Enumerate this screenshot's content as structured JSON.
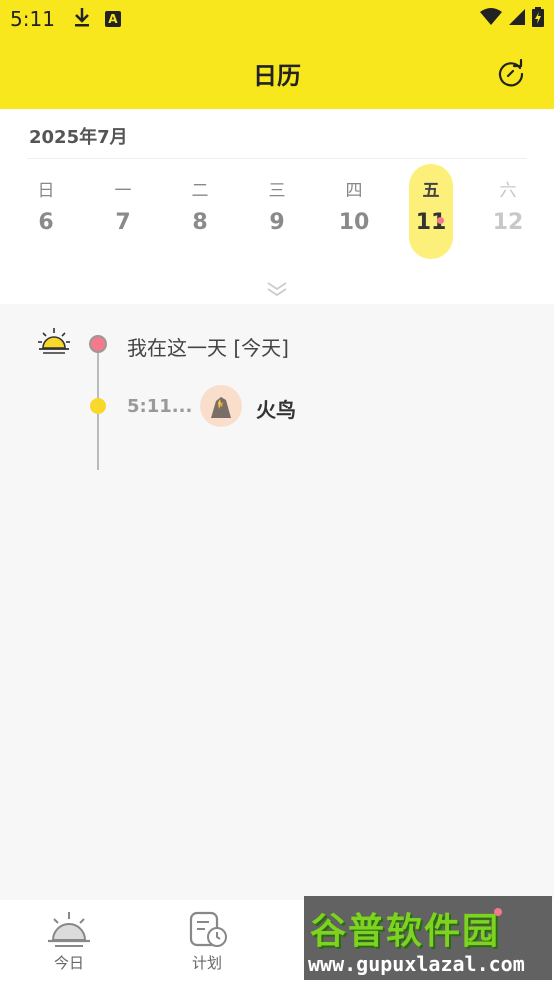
{
  "status_bar": {
    "time": "5:11",
    "download_icon": "download-icon",
    "a_badge": "A"
  },
  "app_bar": {
    "title": "日历",
    "refresh_icon": "refresh-icon"
  },
  "calendar": {
    "month_label": "2025年7月",
    "days": [
      {
        "weekday": "日",
        "date": "6",
        "state": "normal"
      },
      {
        "weekday": "一",
        "date": "7",
        "state": "normal"
      },
      {
        "weekday": "二",
        "date": "8",
        "state": "normal"
      },
      {
        "weekday": "三",
        "date": "9",
        "state": "normal"
      },
      {
        "weekday": "四",
        "date": "10",
        "state": "normal"
      },
      {
        "weekday": "五",
        "date": "11",
        "state": "selected",
        "has_event": true
      },
      {
        "weekday": "六",
        "date": "12",
        "state": "faded"
      }
    ],
    "selected_color": "#fdf07a",
    "event_dot_color": "#f37a8a"
  },
  "timeline": {
    "header": "我在这一天 [今天]",
    "entries": [
      {
        "time": "5:11...",
        "name": "火鸟"
      }
    ]
  },
  "bottom_nav": {
    "items": [
      {
        "label": "今日",
        "icon": "sunrise-icon"
      },
      {
        "label": "计划",
        "icon": "plan-clock-icon"
      }
    ]
  },
  "watermark": {
    "title": "谷普软件园",
    "url": "www.gupuxlazal.com"
  },
  "colors": {
    "brand_yellow": "#f9e71e",
    "accent_pink": "#f37a8a",
    "dot_yellow": "#f9d82c"
  }
}
